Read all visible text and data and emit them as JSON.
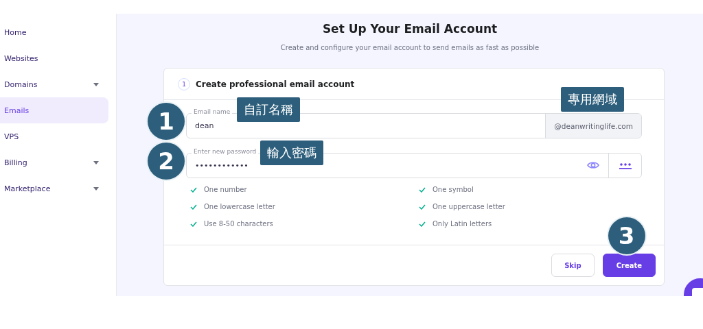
{
  "sidebar": {
    "items": [
      {
        "label": "Home",
        "selected": false,
        "has_submenu": false
      },
      {
        "label": "Websites",
        "selected": false,
        "has_submenu": false
      },
      {
        "label": "Domains",
        "selected": false,
        "has_submenu": true
      },
      {
        "label": "Emails",
        "selected": true,
        "has_submenu": false
      },
      {
        "label": "VPS",
        "selected": false,
        "has_submenu": false
      },
      {
        "label": "Billing",
        "selected": false,
        "has_submenu": true
      },
      {
        "label": "Marketplace",
        "selected": false,
        "has_submenu": true
      }
    ]
  },
  "header": {
    "title": "Set Up Your Email Account",
    "subtitle": "Create and configure your email account to send emails as fast as possible"
  },
  "card": {
    "step": "1",
    "title": "Create professional email account",
    "email_field": {
      "label": "Email name",
      "value": "dean",
      "domain": "@deanwritinglife.com",
      "annotation_number": "1",
      "annotation_label": "自訂名稱",
      "domain_annotation": "專用網域"
    },
    "password_field": {
      "label": "Enter new password",
      "value": "••••••••••••",
      "annotation_number": "2",
      "annotation_label": "輸入密碼"
    },
    "requirements": [
      {
        "label": "One number",
        "met": true
      },
      {
        "label": "One symbol",
        "met": true
      },
      {
        "label": "One lowercase letter",
        "met": true
      },
      {
        "label": "One uppercase letter",
        "met": true
      },
      {
        "label": "Use 8-50 characters",
        "met": true
      },
      {
        "label": "Only Latin letters",
        "met": true
      }
    ],
    "buttons": [
      {
        "label": "Skip",
        "kind": "secondary"
      },
      {
        "label": "Create",
        "kind": "primary",
        "annotation_number": "3"
      }
    ]
  }
}
